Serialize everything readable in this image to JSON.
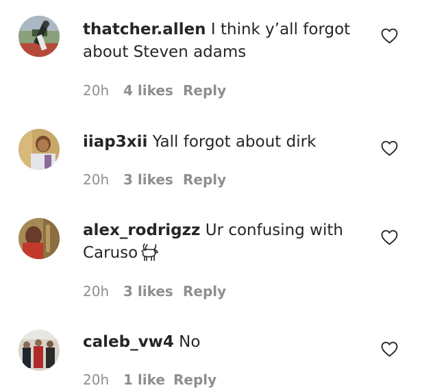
{
  "comments": [
    {
      "username": "thatcher.allen",
      "text": "I think y’all forgot about Steven adams",
      "time": "20h",
      "likes": "4 likes",
      "reply": "Reply",
      "avatar_icon": "user-avatar",
      "like_icon": "heart-outline-icon"
    },
    {
      "username": "iiap3xii",
      "text": "Yall forgot about dirk",
      "time": "20h",
      "likes": "3 likes",
      "reply": "Reply",
      "avatar_icon": "user-avatar",
      "like_icon": "heart-outline-icon"
    },
    {
      "username": "alex_rodrigzz",
      "text": "Ur confusing with Caruso",
      "emoji": "goat-emoji",
      "time": "20h",
      "likes": "3 likes",
      "reply": "Reply",
      "avatar_icon": "user-avatar",
      "like_icon": "heart-outline-icon"
    },
    {
      "username": "caleb_vw4",
      "text": "No",
      "time": "20h",
      "likes": "1 like",
      "reply": "Reply",
      "avatar_icon": "user-avatar",
      "like_icon": "heart-outline-icon"
    }
  ],
  "colors": {
    "text": "#262626",
    "secondary": "#8e8e8e",
    "background": "#ffffff"
  }
}
